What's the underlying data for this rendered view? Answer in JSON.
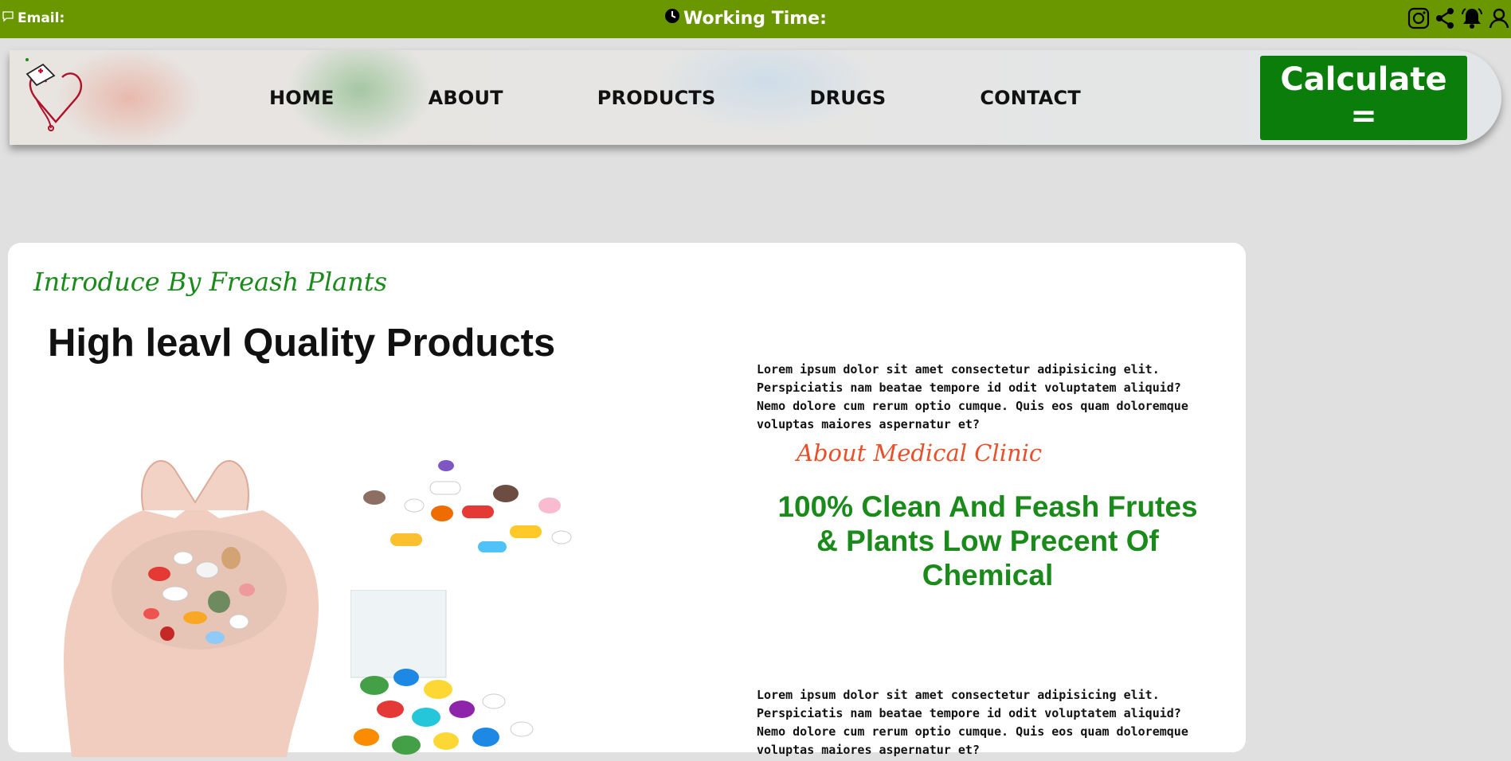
{
  "topbar": {
    "email_label": "Email:",
    "working_time_label": "Working Time:",
    "icons": [
      "instagram-icon",
      "share-icon",
      "bell-icon",
      "user-icon"
    ],
    "bg_color": "#6a9600"
  },
  "nav": {
    "items": [
      "HOME",
      "ABOUT",
      "PRODUCTS",
      "DRUGS",
      "CONTACT"
    ],
    "calculate_label": "Calculate ="
  },
  "hero": {
    "intro": "Introduce By Freash Plants",
    "headline": "High leavl Quality Products",
    "paragraph1": "Lorem ipsum dolor sit amet consectetur adipisicing elit. Perspiciatis nam beatae tempore id odit voluptatem aliquid? Nemo dolore cum rerum optio cumque. Quis eos quam doloremque voluptas maiores aspernatur et?",
    "about_label": "About Medical Clinic",
    "clean_heading": "100% Clean And Feash Frutes & Plants Low Precent Of Chemical",
    "paragraph2": "Lorem ipsum dolor sit amet consectetur adipisicing elit. Perspiciatis nam beatae tempore id odit voluptatem aliquid? Nemo dolore cum rerum optio cumque. Quis eos quam doloremque voluptas maiores aspernatur et?"
  },
  "colors": {
    "accent_green": "#0b7d0b",
    "heading_green": "#1a8a1a",
    "about_orange": "#e8502a"
  }
}
